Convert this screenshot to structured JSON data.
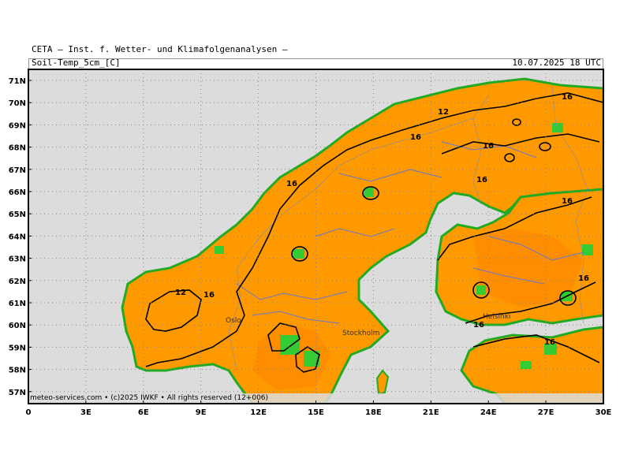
{
  "header": {
    "organization": "CETA — Inst. f. Wetter- und Klimafolgenanalysen —",
    "variable": "Soil-Temp_5cm_[C]",
    "datetime": "10.07.2025 18 UTC"
  },
  "footer": {
    "credit": "meteo-services.com • (c)2025 IWKF • All rights reserved (12+006)"
  },
  "map": {
    "lat_labels": [
      "71N",
      "70N",
      "69N",
      "68N",
      "67N",
      "66N",
      "65N",
      "64N",
      "63N",
      "62N",
      "61N",
      "60N",
      "59N",
      "58N",
      "57N"
    ],
    "lon_labels": [
      "0",
      "3E",
      "6E",
      "9E",
      "12E",
      "15E",
      "18E",
      "21E",
      "24E",
      "27E",
      "30E"
    ],
    "city_labels": [
      "Oslo",
      "Stockholm",
      "Helsinki"
    ],
    "contour_labels": [
      "12",
      "16",
      "16",
      "16",
      "16",
      "16",
      "16",
      "16",
      "12",
      "16",
      "16",
      "16"
    ],
    "colors": {
      "sea": "#dcdcdc",
      "warm": "#ff9900",
      "warmer": "#ff8c00",
      "cool": "#33cc33",
      "coolest": "#22aa22",
      "contour": "#000000",
      "rivers": "#6677cc"
    }
  }
}
